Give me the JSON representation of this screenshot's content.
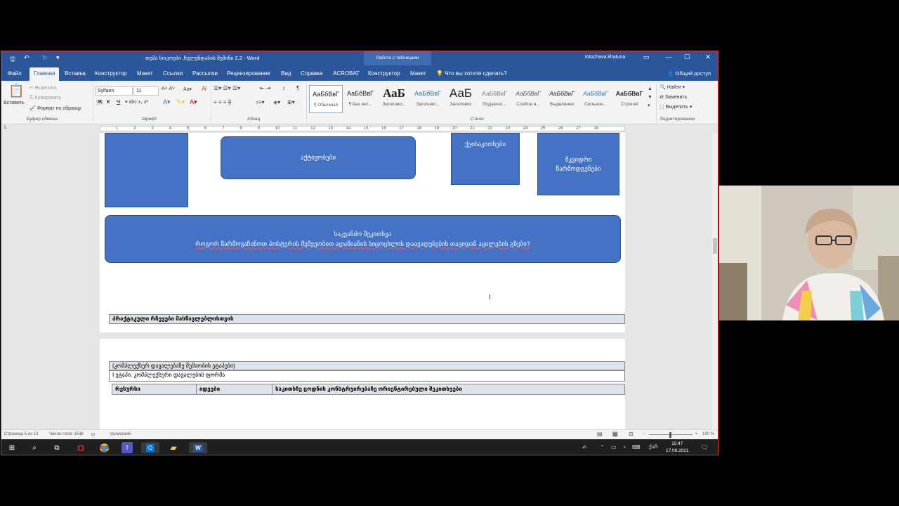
{
  "window": {
    "doc_title": "თემა სოკოები ,ჩელენდაბის შუშინი 2.2  -  Word",
    "context_tab": "Работа с таблицами",
    "user": "totochava.khatuna",
    "minimize": "—",
    "restore": "☐",
    "close": "✕"
  },
  "tabs": [
    "Файл",
    "Главная",
    "Вставка",
    "Конструктор",
    "Макет",
    "Ссылки",
    "Рассылки",
    "Рецензирование",
    "Вид",
    "Справка",
    "ACROBAT",
    "Конструктор",
    "Макет"
  ],
  "active_tab": "Главная",
  "tell_me": "Что вы хотите сделать?",
  "share": "Общий доступ",
  "ribbon": {
    "clipboard": {
      "paste": "Вставить",
      "cut": "Вырезать",
      "copy": "Копировать",
      "format_painter": "Формат по образцу",
      "label": "Буфер обмена"
    },
    "font": {
      "name": "Sylfaen",
      "size": "11",
      "label": "Шрифт",
      "bold": "Ж",
      "italic": "К",
      "underline": "Ч"
    },
    "paragraph": {
      "label": "Абзац"
    },
    "styles": {
      "label": "Стили",
      "items": [
        {
          "sample": "АаБбВвГ",
          "name": "¶ Обычный"
        },
        {
          "sample": "АаБбВвГ",
          "name": "¶ Без инт..."
        },
        {
          "sample": "АаБ",
          "name": "Заголово..."
        },
        {
          "sample": "АаБбВвГ",
          "name": "Заголово..."
        },
        {
          "sample": "АаБ",
          "name": "Заголовок"
        },
        {
          "sample": "АаБбВвГ",
          "name": "Подзагол..."
        },
        {
          "sample": "АаБбВвГ",
          "name": "Слабое в..."
        },
        {
          "sample": "АаБбВвГ",
          "name": "Выделение"
        },
        {
          "sample": "АаБбВвГ",
          "name": "Сильное..."
        },
        {
          "sample": "АаБбВвГ",
          "name": "Строгий"
        }
      ]
    },
    "editing": {
      "label": "Редактирование",
      "find": "Найти",
      "replace": "Заменить",
      "select": "Выделить"
    }
  },
  "ruler_numbers": [
    "1",
    "2",
    "3",
    "4",
    "5",
    "6",
    "7",
    "8",
    "9",
    "10",
    "11",
    "12",
    "13",
    "14",
    "15",
    "16",
    "17",
    "18",
    "19",
    "20",
    "21",
    "22",
    "23",
    "24",
    "25",
    "26",
    "27",
    "28"
  ],
  "document": {
    "shape_activities": "აქტივობები",
    "shape_resources": "ქეისაკითხები",
    "shape_results": "მკვიდრი წარმოდგენები",
    "key_question_title": "საკვანძო შეკითხვა",
    "key_question_text": "როგორ წარმოვაჩინოთ პოსტერის მეშვეობით ადამიანის სიცოცხლის დაავადებების თავიდან აცილების გზები?",
    "practical_tips": "პრაქტიკული რჩევები მასწავლებლისთვის",
    "complex_task_header": "(კომპლექსურ დავალებაზე მუშაობის ეტაპები)",
    "stage1": "I ეტაპი. კომპლექსური დავალების ფორმა",
    "col_headings": [
      "რესურსი",
      "იდეები",
      "საკითხზე ცოდნის კონსტრუირებაზე ორიენტირებული შეკითხვები"
    ]
  },
  "status": {
    "page": "Страница 5 из 12",
    "words": "Число слов: 1548",
    "lang": "грузинский",
    "zoom": "100 %"
  },
  "taskbar": {
    "time": "15:47",
    "date": "17.09.2021",
    "lang": "ქარ"
  }
}
